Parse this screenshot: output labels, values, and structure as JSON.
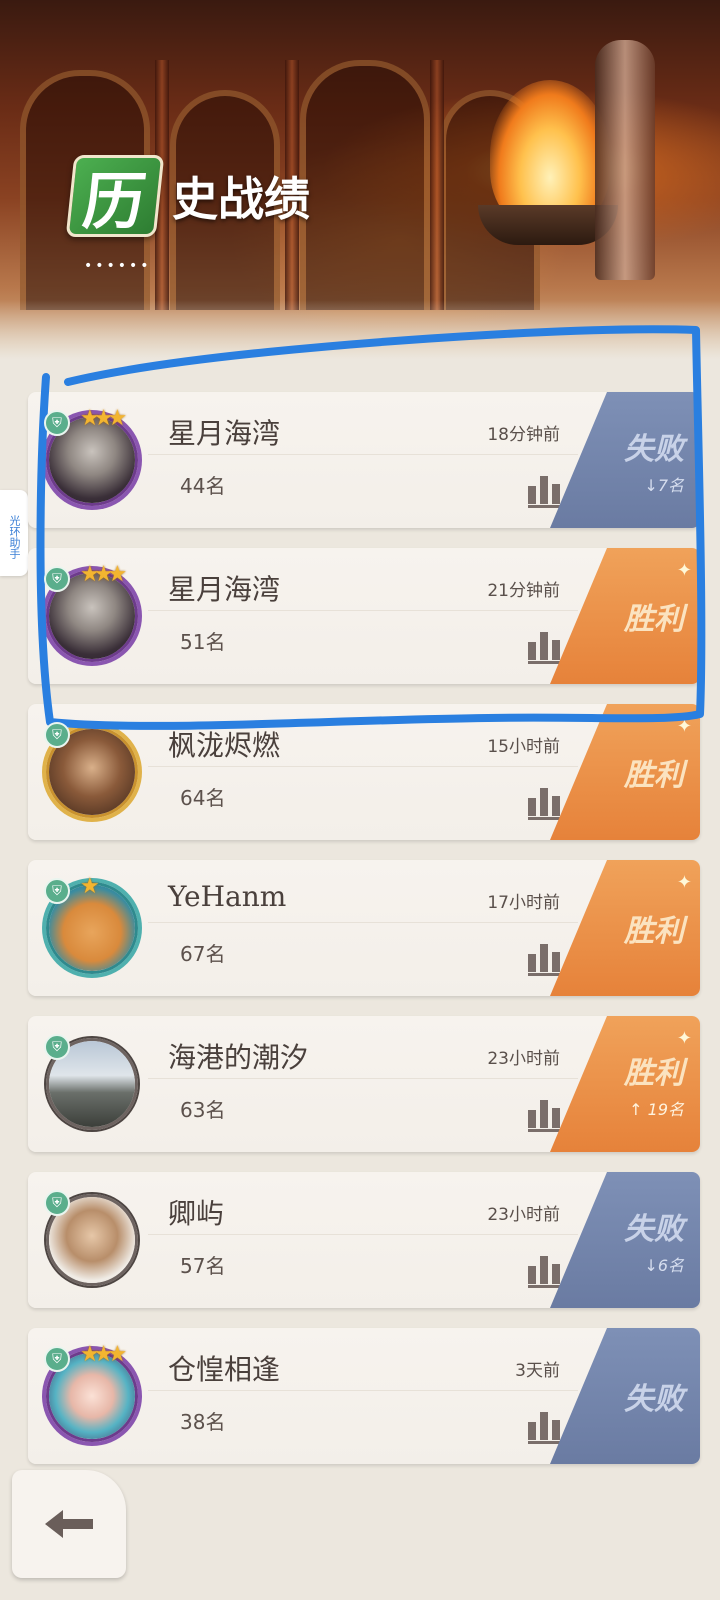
{
  "header": {
    "title_first_char": "历",
    "title_rest": "史战绩",
    "title_dots": "••••••"
  },
  "side_tab": {
    "label": "光环助手"
  },
  "matches": [
    {
      "name": "星月海湾",
      "rank": "44名",
      "time": "18分钟前",
      "result": "失败",
      "result_type": "lose",
      "rank_change": "↓7名",
      "avatar": "bearded-warrior",
      "frame": "purple",
      "stars": "★★★"
    },
    {
      "name": "星月海湾",
      "rank": "51名",
      "time": "21分钟前",
      "result": "胜利",
      "result_type": "win",
      "rank_change": "",
      "avatar": "bearded-warrior",
      "frame": "purple",
      "stars": "★★★"
    },
    {
      "name": "枫泷烬燃",
      "rank": "64名",
      "time": "15小时前",
      "result": "胜利",
      "result_type": "win",
      "rank_change": "",
      "avatar": "photo-couple",
      "frame": "gold",
      "stars": ""
    },
    {
      "name": "YeHanm",
      "rank": "67名",
      "time": "17小时前",
      "result": "胜利",
      "result_type": "win",
      "rank_change": "",
      "avatar": "cartoon-blob",
      "frame": "teal",
      "stars": "★"
    },
    {
      "name": "海港的潮汐",
      "rank": "63名",
      "time": "23小时前",
      "result": "胜利",
      "result_type": "win",
      "rank_change": "↑ 19名",
      "avatar": "landscape-photo",
      "frame": "plain",
      "stars": ""
    },
    {
      "name": "卿屿",
      "rank": "57名",
      "time": "23小时前",
      "result": "失败",
      "result_type": "lose",
      "rank_change": "↓6名",
      "avatar": "anime-man",
      "frame": "plain",
      "stars": ""
    },
    {
      "name": "仓惶相逢",
      "rank": "38名",
      "time": "3天前",
      "result": "失败",
      "result_type": "lose",
      "rank_change": "",
      "avatar": "anime-girl",
      "frame": "purple",
      "stars": "★★★"
    }
  ],
  "colors": {
    "win": "#e6823a",
    "lose": "#6a7ba2",
    "annotation": "#2a7fe0",
    "badge_green": "#3f9a45"
  },
  "icons": {
    "shield": "shield-icon",
    "stats": "bar-chart-icon",
    "back": "back-arrow-icon"
  }
}
